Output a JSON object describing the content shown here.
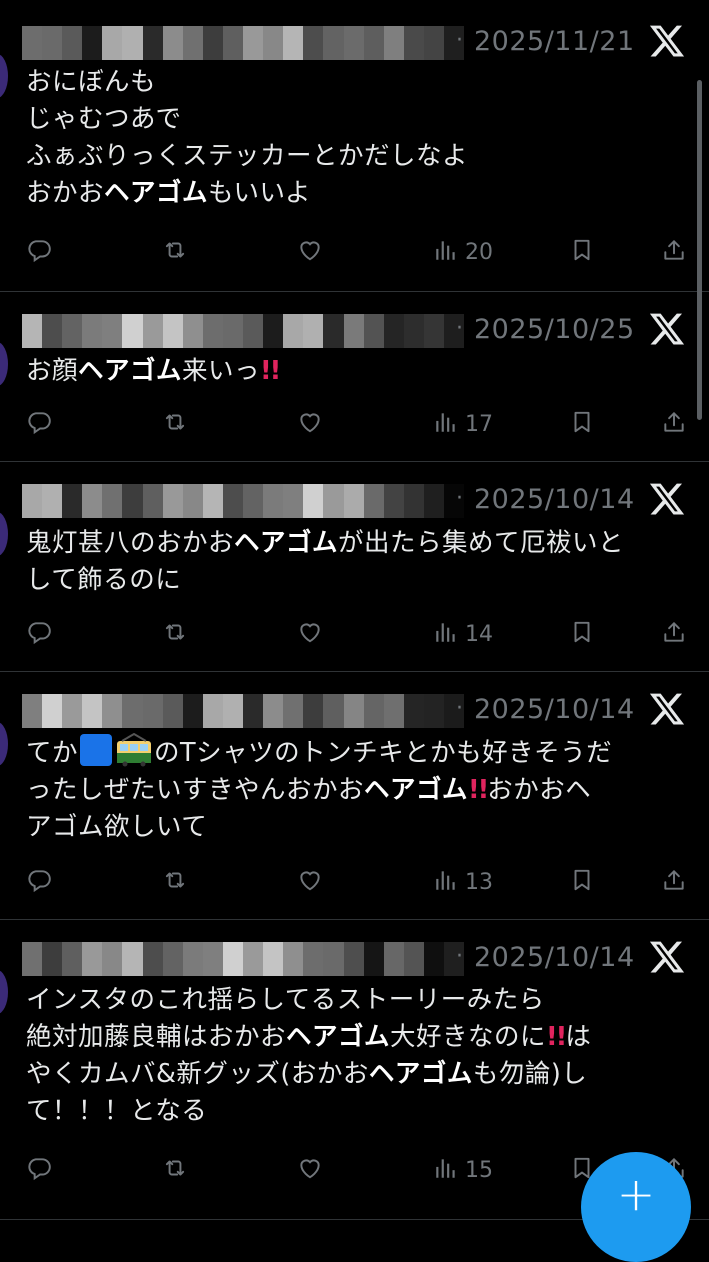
{
  "tweets": [
    {
      "date": "2025/11/21",
      "lines": [
        [
          {
            "t": "おにぼんも"
          }
        ],
        [
          {
            "t": "じゃむつあで"
          }
        ],
        [
          {
            "t": "ふぁぶりっくステッカーとかだしなよ"
          }
        ],
        [
          {
            "t": "おかお"
          },
          {
            "t": "ヘアゴム",
            "bold": true
          },
          {
            "t": "もいいよ"
          }
        ]
      ],
      "views": "20"
    },
    {
      "date": "2025/10/25",
      "lines": [
        [
          {
            "t": "お顔"
          },
          {
            "t": "ヘアゴム",
            "bold": true
          },
          {
            "t": "来いっ"
          },
          {
            "t": "!!",
            "bang": true
          }
        ]
      ],
      "views": "17"
    },
    {
      "date": "2025/10/14",
      "lines": [
        [
          {
            "t": "鬼灯甚八のおかお"
          },
          {
            "t": "ヘアゴム",
            "bold": true
          },
          {
            "t": "が出たら集めて厄祓いと"
          }
        ],
        [
          {
            "t": "して飾るのに"
          }
        ]
      ],
      "views": "14"
    },
    {
      "date": "2025/10/14",
      "lines": [
        [
          {
            "t": "てか"
          },
          {
            "emoji": "blue-square"
          },
          {
            "emoji": "tram"
          },
          {
            "t": "のTシャツのトンチキとかも好きそうだ"
          }
        ],
        [
          {
            "t": "ったしぜたいすきやんおかお"
          },
          {
            "t": "ヘアゴム",
            "bold": true
          },
          {
            "t": "!!",
            "bang": true
          },
          {
            "t": "おかおヘ"
          }
        ],
        [
          {
            "t": "アゴム欲しいて"
          }
        ]
      ],
      "views": "13"
    },
    {
      "date": "2025/10/14",
      "lines": [
        [
          {
            "t": "インスタのこれ揺らしてるストーリーみたら"
          }
        ],
        [
          {
            "t": "絶対加藤良輔はおかお"
          },
          {
            "t": "ヘアゴム",
            "bold": true
          },
          {
            "t": "大好きなのに"
          },
          {
            "t": "!!",
            "bang": true
          },
          {
            "t": "は"
          }
        ],
        [
          {
            "t": "やくカムバ&新グッズ(おかお"
          },
          {
            "t": "ヘアゴム",
            "bold": true
          },
          {
            "t": "も勿論)し"
          }
        ],
        [
          {
            "t": "て！！！となる"
          }
        ]
      ],
      "views": "15"
    }
  ],
  "separator": "·",
  "fab_label": "+",
  "icons": {
    "source": "x-logo-icon",
    "reply": "reply-icon",
    "retweet": "retweet-icon",
    "like": "heart-icon",
    "views": "views-bar-icon",
    "bookmark": "bookmark-icon",
    "share": "share-icon"
  },
  "colors": {
    "background": "#000000",
    "text": "#e7e9ea",
    "muted": "#71767b",
    "divider": "#2f3336",
    "accent": "#1d9bf0",
    "bang": "#e0245e"
  }
}
